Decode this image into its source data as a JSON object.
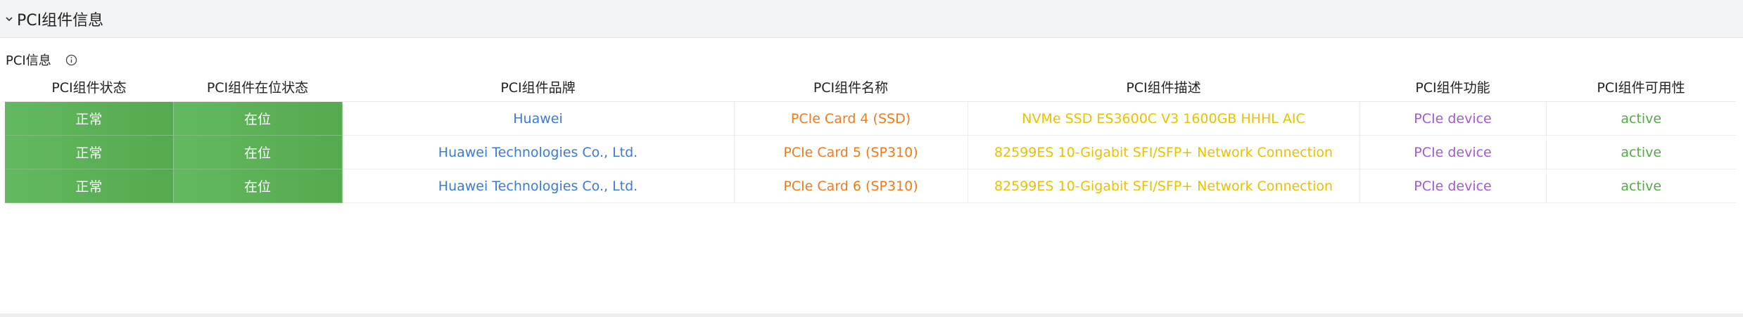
{
  "section": {
    "title": "PCI组件信息",
    "chevron_icon": "chevron-down-icon"
  },
  "subheader": {
    "label": "PCI信息",
    "info_icon": "info-circle-icon"
  },
  "table": {
    "headers": {
      "status": "PCI组件状态",
      "presence": "PCI组件在位状态",
      "brand": "PCI组件品牌",
      "name": "PCI组件名称",
      "description": "PCI组件描述",
      "function": "PCI组件功能",
      "availability": "PCI组件可用性"
    },
    "rows": [
      {
        "status": "正常",
        "presence": "在位",
        "brand": "Huawei",
        "name": "PCIe Card 4 (SSD)",
        "description": "NVMe SSD ES3600C V3 1600GB HHHL AIC",
        "function": "PCIe device",
        "availability": "active"
      },
      {
        "status": "正常",
        "presence": "在位",
        "brand": "Huawei Technologies Co., Ltd.",
        "name": "PCIe Card 5 (SP310)",
        "description": "82599ES 10-Gigabit SFI/SFP+ Network Connection",
        "function": "PCIe device",
        "availability": "active"
      },
      {
        "status": "正常",
        "presence": "在位",
        "brand": "Huawei Technologies Co., Ltd.",
        "name": "PCIe Card 6 (SP310)",
        "description": "82599ES 10-Gigabit SFI/SFP+ Network Connection",
        "function": "PCIe device",
        "availability": "active"
      }
    ]
  },
  "colors": {
    "status_green": "#5cb85c",
    "brand_blue": "#3a7bd5",
    "name_orange": "#f07b1a",
    "desc_yellow": "#e9c100",
    "func_purple": "#a259d9",
    "avail_green": "#4fae3f"
  }
}
